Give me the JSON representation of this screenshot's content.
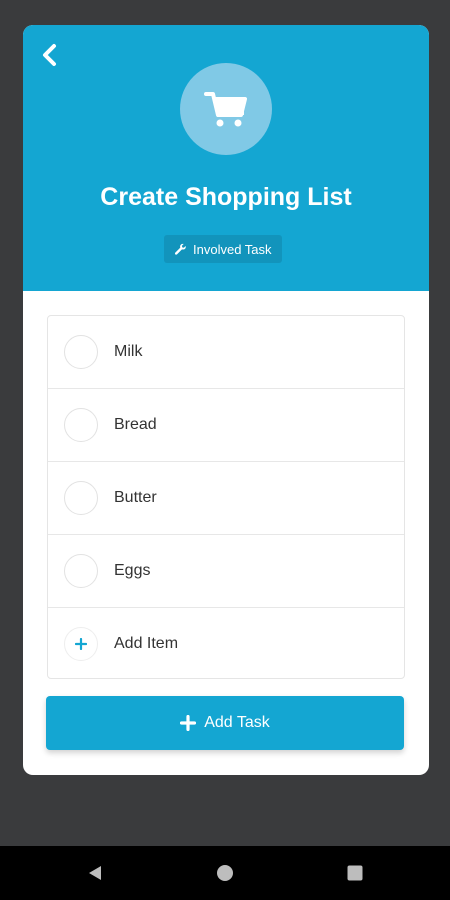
{
  "header": {
    "title": "Create Shopping List",
    "badge_label": "Involved Task",
    "back_icon": "chevron-left-icon",
    "main_icon": "shopping-cart-icon",
    "badge_icon": "wrench-icon"
  },
  "checklist": {
    "items": [
      {
        "label": "Milk",
        "checked": false
      },
      {
        "label": "Bread",
        "checked": false
      },
      {
        "label": "Butter",
        "checked": false
      },
      {
        "label": "Eggs",
        "checked": false
      }
    ],
    "add_item_label": "Add Item"
  },
  "actions": {
    "add_task_label": "Add Task"
  },
  "nav": {
    "back": "back-triangle-icon",
    "home": "home-circle-icon",
    "recents": "recents-square-icon"
  },
  "colors": {
    "accent": "#14a6d2",
    "background": "#3a3b3d",
    "card": "#ffffff"
  }
}
